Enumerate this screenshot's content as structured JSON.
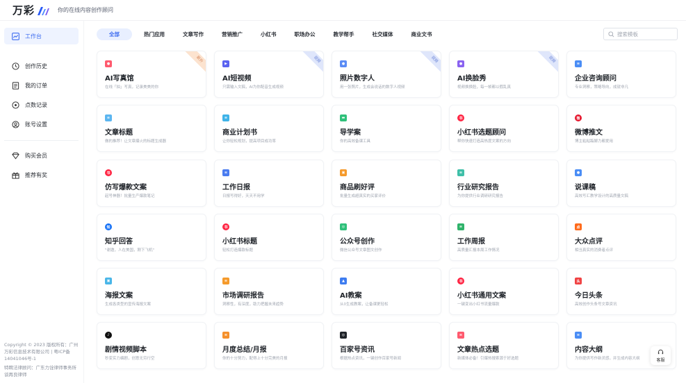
{
  "header": {
    "logo_text": "万彩",
    "slogan": "你的在线内容创作顾问"
  },
  "sidebar": {
    "items": [
      {
        "label": "工作台",
        "icon": "chart-icon"
      },
      {
        "label": "创作历史",
        "icon": "history-icon"
      },
      {
        "label": "我的订单",
        "icon": "order-icon"
      },
      {
        "label": "点数记录",
        "icon": "points-icon"
      },
      {
        "label": "账号设置",
        "icon": "account-icon"
      },
      {
        "label": "购买会员",
        "icon": "diamond-icon"
      },
      {
        "label": "推荐有奖",
        "icon": "gift-icon"
      }
    ],
    "copyright": "Copyright © 2023 版权所有：广州万彩信息技术有限公司 | 粤ICP备14041046号-1",
    "legal": "特聘法律顾问：广东力诠律师事务所谈再良律师"
  },
  "tabs": [
    "全部",
    "热门应用",
    "文章写作",
    "营销推广",
    "小红书",
    "职场办公",
    "教学帮手",
    "社交媒体",
    "商业文书"
  ],
  "search": {
    "placeholder": "搜索模板"
  },
  "cards": [
    {
      "title": "AI写真馆",
      "desc": "在线「拍」写真，记录美美的你",
      "badge": "新升",
      "icon": "camera-icon"
    },
    {
      "title": "AI短视频",
      "desc": "只需输入文稿，AI为你配音生成视频",
      "badge": "视频",
      "icon": "video-icon"
    },
    {
      "title": "照片数字人",
      "desc": "用一张照片，生成会说话的数字人视频",
      "badge": "视频",
      "icon": "digital-human-icon"
    },
    {
      "title": "AI换脸秀",
      "desc": "视频换换脸，每一帧都以假乱真",
      "badge": "视频",
      "icon": "face-swap-icon"
    },
    {
      "title": "企业咨询顾问",
      "desc": "专业洞察，策略导向，成就非凡",
      "badge": "",
      "icon": "consult-icon"
    },
    {
      "title": "文章标题",
      "desc": "做的推荐！让文章爆火的标题生成器",
      "badge": "",
      "icon": "article-icon"
    },
    {
      "title": "商业计划书",
      "desc": "让你轻松规划，提高项目成功率",
      "badge": "",
      "icon": "plan-icon"
    },
    {
      "title": "导学案",
      "desc": "你的高效备课工具",
      "badge": "",
      "icon": "study-icon"
    },
    {
      "title": "小红书选题顾问",
      "desc": "帮你快速打造高热度文案的方向",
      "badge": "",
      "icon": "xhs-icon"
    },
    {
      "title": "微博推文",
      "desc": "博主粘粘踮脚力都爱用",
      "badge": "",
      "icon": "weibo-icon"
    },
    {
      "title": "仿写爆款文案",
      "desc": "起号神器！批量生产爆款笔记",
      "badge": "",
      "icon": "xhs-icon"
    },
    {
      "title": "工作日报",
      "desc": "日报写得好，天天不用学",
      "badge": "",
      "icon": "report-icon"
    },
    {
      "title": "商品刷好评",
      "desc": "批量生成超真实的买家评价",
      "badge": "",
      "icon": "shop-icon"
    },
    {
      "title": "行业研究报告",
      "desc": "为你提供行业调研研究报告",
      "badge": "",
      "icon": "research-icon"
    },
    {
      "title": "说课稿",
      "desc": "高效写汇教学设计的高质量文稿",
      "badge": "",
      "icon": "teach-icon"
    },
    {
      "title": "知乎回答",
      "desc": "\"谢邀，人在美国，刚下飞机\"",
      "badge": "",
      "icon": "zhihu-icon"
    },
    {
      "title": "小红书标题",
      "desc": "轻松打造爆款标题",
      "badge": "",
      "icon": "xhs-icon"
    },
    {
      "title": "公众号创作",
      "desc": "微信公众号文章图文创作",
      "badge": "",
      "icon": "wechat-icon"
    },
    {
      "title": "工作周报",
      "desc": "高质量汇报本周工作情况",
      "badge": "",
      "icon": "weekly-icon"
    },
    {
      "title": "大众点评",
      "desc": "相当真实的消费者点评",
      "badge": "",
      "icon": "dianping-icon"
    },
    {
      "title": "海报文案",
      "desc": "生成各类型的宣传海报文案",
      "badge": "",
      "icon": "poster-icon"
    },
    {
      "title": "市场调研报告",
      "desc": "洞察性，有深度，助力把握未来趋势",
      "badge": "",
      "icon": "market-icon"
    },
    {
      "title": "AI教案",
      "desc": "从0生成教案，让备课更轻松",
      "badge": "",
      "icon": "graduation-icon"
    },
    {
      "title": "小红书通用文案",
      "desc": "一键变出小红书流量爆款",
      "badge": "",
      "icon": "xhs-icon"
    },
    {
      "title": "今日头条",
      "desc": "高效创作头条号文章资讯",
      "badge": "",
      "icon": "toutiao-icon"
    },
    {
      "title": "剧情视频脚本",
      "desc": "秒变实力编剧，创意无穷行空",
      "badge": "",
      "icon": "tiktok-icon"
    },
    {
      "title": "月度总结/月报",
      "desc": "你的十分努力，配得上十分完美的月报",
      "badge": "",
      "icon": "monthly-icon"
    },
    {
      "title": "百家号资讯",
      "desc": "根据热点资讯，一键创作百家号新闻",
      "badge": "",
      "icon": "baijia-icon"
    },
    {
      "title": "文章热点选题",
      "desc": "新媒体必备！引爆热搜索源于好选题",
      "badge": "",
      "icon": "hot-topic-icon"
    },
    {
      "title": "内容大纲",
      "desc": "为你提供写作新灵感，并生成内容大纲",
      "badge": "",
      "icon": "outline-icon"
    }
  ],
  "help": {
    "label": "客服"
  },
  "colors": {
    "accent": "#3d6cf0",
    "xhs_red": "#ff2442",
    "upgrade": "#d4845a"
  }
}
